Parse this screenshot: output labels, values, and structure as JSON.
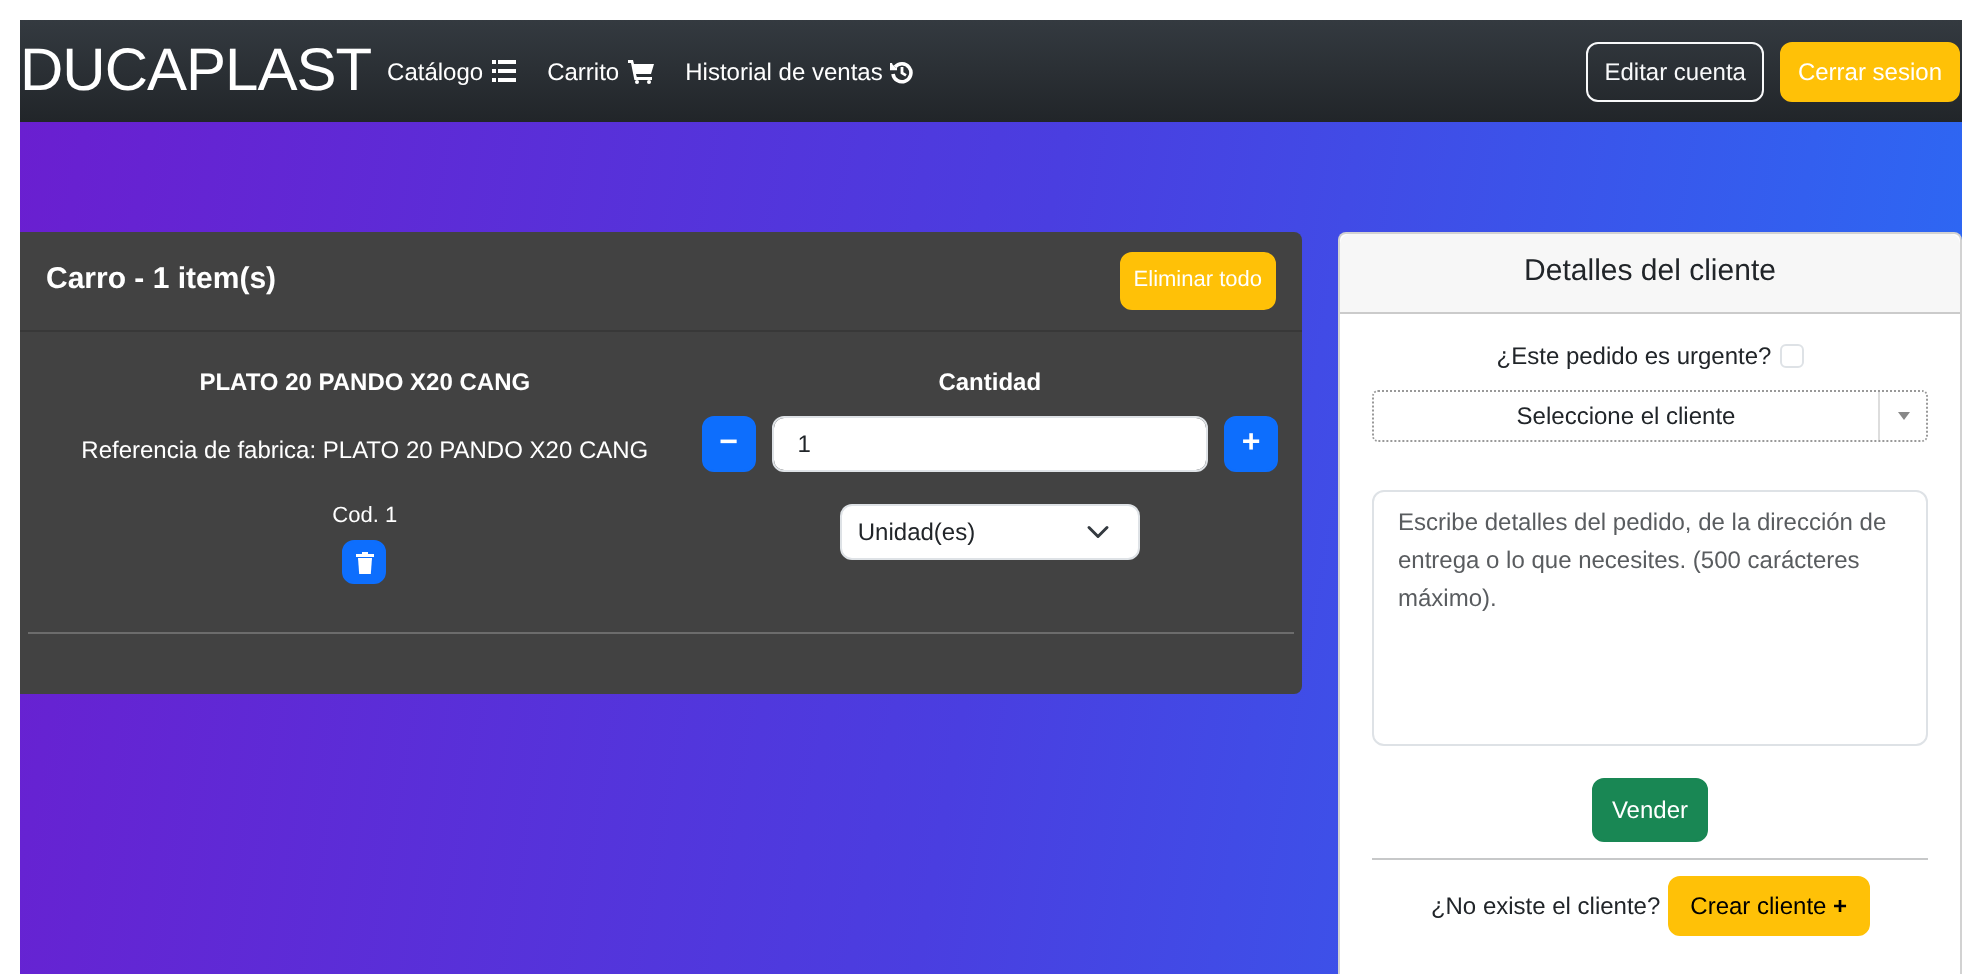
{
  "navbar": {
    "brand": "DUCAPLAST",
    "links": [
      {
        "label": "Catálogo"
      },
      {
        "label": "Carrito"
      },
      {
        "label": "Historial de ventas"
      }
    ],
    "buttons": [
      {
        "label": "Editar cuenta",
        "kind": "outline"
      },
      {
        "label": "Cerrar sesion",
        "kind": "warning"
      }
    ]
  },
  "cart": {
    "title": "Carro - 1 item(s)",
    "clear_button": "Eliminar todo",
    "items": [
      {
        "name": "PLATO 20 PANDO X20 CANG",
        "reference": "Referencia de fabrica: PLATO 20 PANDO X20 CANG",
        "code": "Cod. 1",
        "quantity_label": "Cantidad",
        "minus": "−",
        "quantity": "1",
        "plus": "+",
        "unit": "Unidad(es)"
      }
    ]
  },
  "client": {
    "title": "Detalles del cliente",
    "urgent_label": "¿Este pedido es urgente?",
    "urgent": false,
    "client_select": "Seleccione el cliente",
    "notes_placeholder": "Escribe detalles del pedido, de la dirección de entrega o lo que necesites. (500 carácteres máximo).",
    "sell_button": "Vender",
    "no_client_text": "¿No existe el cliente?",
    "create_button": "Crear cliente",
    "create_icon": "+"
  }
}
